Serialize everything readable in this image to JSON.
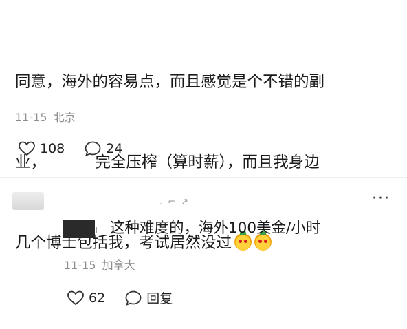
{
  "comment": {
    "lines": [
      "同意，海外的容易点，而且感觉是个不错的副",
      "业，          完全压榨（算时薪），而且我身边",
      "几个博士包括我，考试居然没过"
    ],
    "emojis": [
      "chili-face-emoji",
      "chili-face-emoji"
    ],
    "date": "11-15",
    "location": "北京",
    "likes": "108",
    "replies": "24"
  },
  "reply": {
    "text": "这种难度的，海外100美金/小时",
    "date": "11-15",
    "location": "加拿大",
    "likes": "62",
    "reply_label": "回复",
    "more_label": "···"
  },
  "colors": {
    "text": "#1a1a1a",
    "meta": "#8c8c8c",
    "divider": "#efefef"
  }
}
